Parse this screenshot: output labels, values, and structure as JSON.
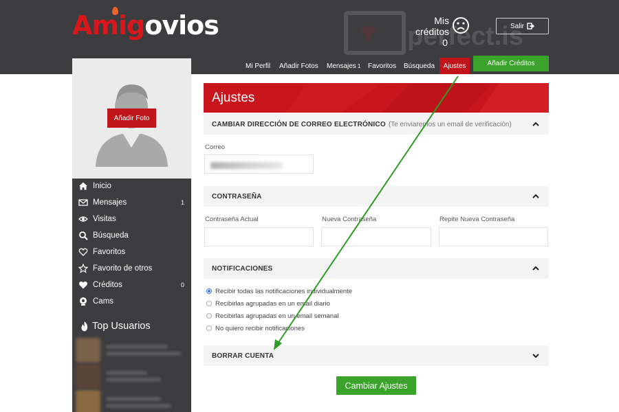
{
  "header": {
    "logo_part1": "Amig",
    "logo_part2": "ovios",
    "watermark_text": "perfect.is",
    "credits_label": "Mis créditos",
    "credits_value": "0",
    "logout_label": "Salir",
    "nav": [
      {
        "label": "Mi Perfil"
      },
      {
        "label": "Añadir Fotos"
      },
      {
        "label": "Mensajes",
        "badge": "1"
      },
      {
        "label": "Favoritos"
      },
      {
        "label": "Búsqueda"
      },
      {
        "label": "Ajustes",
        "active": true
      }
    ],
    "add_credits_label": "Añadir Créditos"
  },
  "sidebar": {
    "add_photo_label": "Añadir Foto",
    "items": [
      {
        "label": "Inicio",
        "icon": "home-icon"
      },
      {
        "label": "Mensajes",
        "icon": "envelope-icon",
        "count": "1"
      },
      {
        "label": "Visitas",
        "icon": "eye-icon"
      },
      {
        "label": "Búsqueda",
        "icon": "search-icon"
      },
      {
        "label": "Favoritos",
        "icon": "heart-icon"
      },
      {
        "label": "Favorito de otros",
        "icon": "star-icon"
      },
      {
        "label": "Créditos",
        "icon": "heart-icon",
        "count": "0"
      },
      {
        "label": "Cams",
        "icon": "webcam-icon"
      }
    ],
    "top_users_title": "Top Usuarios"
  },
  "main": {
    "title": "Ajustes",
    "email_section": {
      "heading": "CAMBIAR DIRECCIÓN DE CORREO ELECTRÓNICO",
      "note": "(Te enviaremos un email de verificación)",
      "field_label": "Correo"
    },
    "password_section": {
      "heading": "CONTRASEÑA",
      "fields": [
        "Contraseña Actual",
        "Nueva Contraseña",
        "Repite Nueva Contraseña"
      ]
    },
    "notifications_section": {
      "heading": "NOTIFICACIONES",
      "options": [
        {
          "label": "Recibir todas las notificaciones individualmente",
          "checked": true
        },
        {
          "label": "Recibirlas agrupadas en un email diario",
          "checked": false
        },
        {
          "label": "Recibirlas agrupadas en un email semanal",
          "checked": false
        },
        {
          "label": "No quiero recibir notificaciones",
          "checked": false
        }
      ]
    },
    "delete_section": {
      "heading": "BORRAR CUENTA"
    },
    "save_label": "Cambiar Ajustes"
  },
  "colors": {
    "header_bg": "#3d3d40",
    "brand_red": "#c8161c",
    "action_green": "#3aa329",
    "annotation_arrow": "#2f9a25"
  }
}
